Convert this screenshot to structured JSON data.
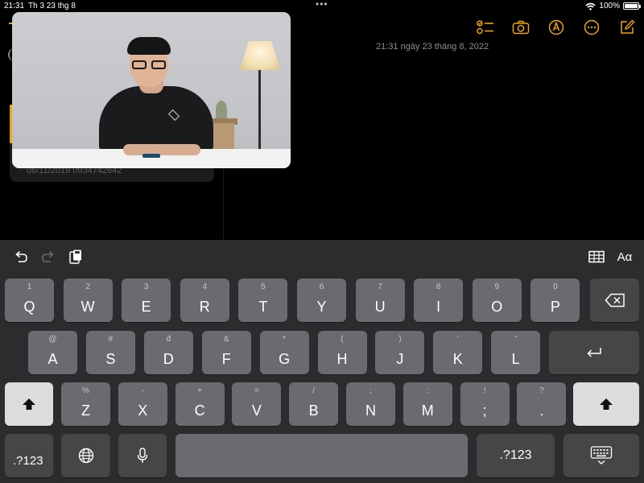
{
  "status_bar": {
    "time": "21:31",
    "date": "Th 3 23 thg 8",
    "multitask_dots": "•••",
    "battery": "100%",
    "battery_level": 1.0
  },
  "notes": {
    "editor_timestamp": "21:31 ngày 23 tháng 8, 2022",
    "note_meta": "06/11/2019  0934742642",
    "accent_color": "#e6a61c"
  },
  "toolbar": {
    "icons": [
      "checklist-icon",
      "camera-icon",
      "markup-icon",
      "more-icon",
      "compose-icon"
    ]
  },
  "keyboard": {
    "text_format_label": "Aα",
    "rows": {
      "row1": [
        {
          "main": "Q",
          "hint": "1"
        },
        {
          "main": "W",
          "hint": "2"
        },
        {
          "main": "E",
          "hint": "3"
        },
        {
          "main": "R",
          "hint": "4"
        },
        {
          "main": "T",
          "hint": "5"
        },
        {
          "main": "Y",
          "hint": "6"
        },
        {
          "main": "U",
          "hint": "7"
        },
        {
          "main": "I",
          "hint": "8"
        },
        {
          "main": "O",
          "hint": "9"
        },
        {
          "main": "P",
          "hint": "0"
        }
      ],
      "row2": [
        {
          "main": "A",
          "hint": "@"
        },
        {
          "main": "S",
          "hint": "#"
        },
        {
          "main": "D",
          "hint": "đ"
        },
        {
          "main": "F",
          "hint": "&"
        },
        {
          "main": "G",
          "hint": "*"
        },
        {
          "main": "H",
          "hint": "("
        },
        {
          "main": "J",
          "hint": ")"
        },
        {
          "main": "K",
          "hint": "’"
        },
        {
          "main": "L",
          "hint": "”"
        }
      ],
      "row3": [
        {
          "main": "Z",
          "hint": "%"
        },
        {
          "main": "X",
          "hint": "-"
        },
        {
          "main": "C",
          "hint": "+"
        },
        {
          "main": "V",
          "hint": "="
        },
        {
          "main": "B",
          "hint": "/"
        },
        {
          "main": "N",
          "hint": ";"
        },
        {
          "main": "M",
          "hint": ":"
        },
        {
          "main": ";",
          "hint": "!"
        },
        {
          "main": ".",
          "hint": "?"
        }
      ]
    },
    "numbers_label_left": ".?123",
    "numbers_label_right": ".?123"
  }
}
